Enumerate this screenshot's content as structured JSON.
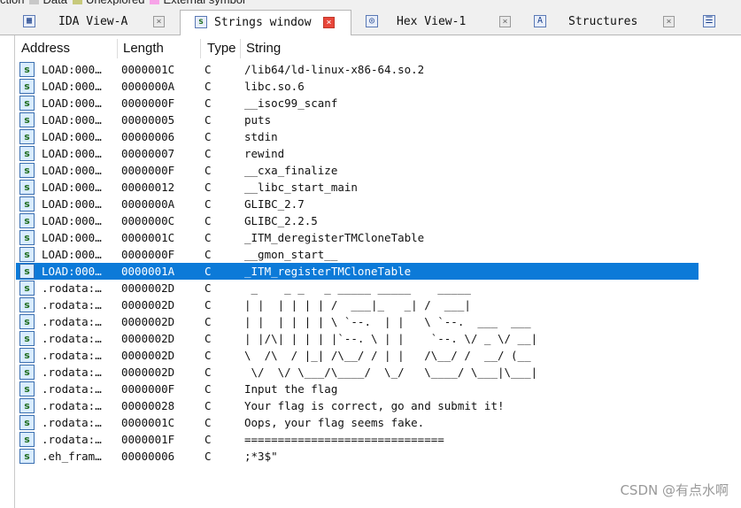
{
  "legend": [
    {
      "label": "ction",
      "color": ""
    },
    {
      "label": "Data",
      "color": "#c8c8c8"
    },
    {
      "label": "Unexplored",
      "color": "#c7c97b"
    },
    {
      "label": "External symbol",
      "color": "#f7a3e8"
    }
  ],
  "tabs": [
    {
      "label": "IDA View-A",
      "icon": "ida-view-icon",
      "active": false
    },
    {
      "label": "Strings window",
      "icon": "strings-icon",
      "active": true
    },
    {
      "label": "Hex View-1",
      "icon": "hex-view-icon",
      "active": false
    },
    {
      "label": "Structures",
      "icon": "structures-icon",
      "active": false
    }
  ],
  "close_glyph": "×",
  "columns": {
    "address": "Address",
    "length": "Length",
    "type": "Type",
    "string": "String"
  },
  "rows": [
    {
      "address": "LOAD:000…",
      "length": "0000001C",
      "type": "C",
      "string": "/lib64/ld-linux-x86-64.so.2"
    },
    {
      "address": "LOAD:000…",
      "length": "0000000A",
      "type": "C",
      "string": "libc.so.6"
    },
    {
      "address": "LOAD:000…",
      "length": "0000000F",
      "type": "C",
      "string": "__isoc99_scanf"
    },
    {
      "address": "LOAD:000…",
      "length": "00000005",
      "type": "C",
      "string": "puts"
    },
    {
      "address": "LOAD:000…",
      "length": "00000006",
      "type": "C",
      "string": "stdin"
    },
    {
      "address": "LOAD:000…",
      "length": "00000007",
      "type": "C",
      "string": "rewind"
    },
    {
      "address": "LOAD:000…",
      "length": "0000000F",
      "type": "C",
      "string": "__cxa_finalize"
    },
    {
      "address": "LOAD:000…",
      "length": "00000012",
      "type": "C",
      "string": "__libc_start_main"
    },
    {
      "address": "LOAD:000…",
      "length": "0000000A",
      "type": "C",
      "string": "GLIBC_2.7"
    },
    {
      "address": "LOAD:000…",
      "length": "0000000C",
      "type": "C",
      "string": "GLIBC_2.2.5"
    },
    {
      "address": "LOAD:000…",
      "length": "0000001C",
      "type": "C",
      "string": "_ITM_deregisterTMCloneTable"
    },
    {
      "address": "LOAD:000…",
      "length": "0000000F",
      "type": "C",
      "string": "__gmon_start__"
    },
    {
      "address": "LOAD:000…",
      "length": "0000001A",
      "type": "C",
      "string": "_ITM_registerTMCloneTable",
      "selected": true
    },
    {
      "address": ".rodata:…",
      "length": "0000002D",
      "type": "C",
      "string": " _    _ _   _ _____ _____    _____"
    },
    {
      "address": ".rodata:…",
      "length": "0000002D",
      "type": "C",
      "string": "| |  | | | | /  ___|_   _| /  ___|"
    },
    {
      "address": ".rodata:…",
      "length": "0000002D",
      "type": "C",
      "string": "| |  | | | | \\ `--.  | |   \\ `--.  ___  ___"
    },
    {
      "address": ".rodata:…",
      "length": "0000002D",
      "type": "C",
      "string": "| |/\\| | | | |`--. \\ | |    `--. \\/ _ \\/ __|"
    },
    {
      "address": ".rodata:…",
      "length": "0000002D",
      "type": "C",
      "string": "\\  /\\  / |_| /\\__/ / | |   /\\__/ /  __/ (__"
    },
    {
      "address": ".rodata:…",
      "length": "0000002D",
      "type": "C",
      "string": " \\/  \\/ \\___/\\____/  \\_/   \\____/ \\___|\\___|"
    },
    {
      "address": ".rodata:…",
      "length": "0000000F",
      "type": "C",
      "string": "Input the flag"
    },
    {
      "address": ".rodata:…",
      "length": "00000028",
      "type": "C",
      "string": "Your flag is correct, go and submit it!"
    },
    {
      "address": ".rodata:…",
      "length": "0000001C",
      "type": "C",
      "string": "Oops, your flag seems fake."
    },
    {
      "address": ".rodata:…",
      "length": "0000001F",
      "type": "C",
      "string": "=============================="
    },
    {
      "address": ".eh_fram…",
      "length": "00000006",
      "type": "C",
      "string": ";*3$\""
    }
  ],
  "string_icon_glyph": "s",
  "watermark": "CSDN @有点水啊"
}
